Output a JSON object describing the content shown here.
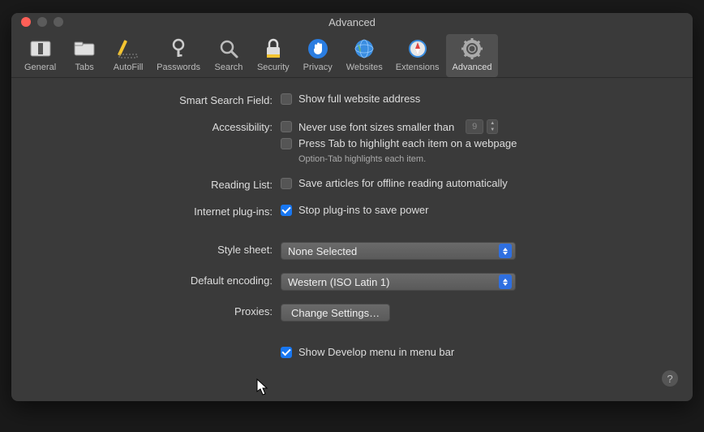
{
  "window": {
    "title": "Advanced"
  },
  "toolbar": {
    "items": [
      {
        "label": "General"
      },
      {
        "label": "Tabs"
      },
      {
        "label": "AutoFill"
      },
      {
        "label": "Passwords"
      },
      {
        "label": "Search"
      },
      {
        "label": "Security"
      },
      {
        "label": "Privacy"
      },
      {
        "label": "Websites"
      },
      {
        "label": "Extensions"
      },
      {
        "label": "Advanced"
      }
    ],
    "selected_index": 9
  },
  "sections": {
    "smart_search": {
      "label": "Smart Search Field:",
      "show_full_address": {
        "label": "Show full website address",
        "checked": false
      }
    },
    "accessibility": {
      "label": "Accessibility:",
      "min_font": {
        "label": "Never use font sizes smaller than",
        "checked": false,
        "value": "9"
      },
      "tab_highlight": {
        "label": "Press Tab to highlight each item on a webpage",
        "checked": false
      },
      "hint": "Option-Tab highlights each item."
    },
    "reading_list": {
      "label": "Reading List:",
      "offline": {
        "label": "Save articles for offline reading automatically",
        "checked": false
      }
    },
    "plugins": {
      "label": "Internet plug-ins:",
      "stop_power": {
        "label": "Stop plug-ins to save power",
        "checked": true
      }
    },
    "style_sheet": {
      "label": "Style sheet:",
      "value": "None Selected"
    },
    "default_encoding": {
      "label": "Default encoding:",
      "value": "Western (ISO Latin 1)"
    },
    "proxies": {
      "label": "Proxies:",
      "button": "Change Settings…"
    },
    "develop": {
      "label": "Show Develop menu in menu bar",
      "checked": true
    }
  },
  "help_tooltip": "?"
}
